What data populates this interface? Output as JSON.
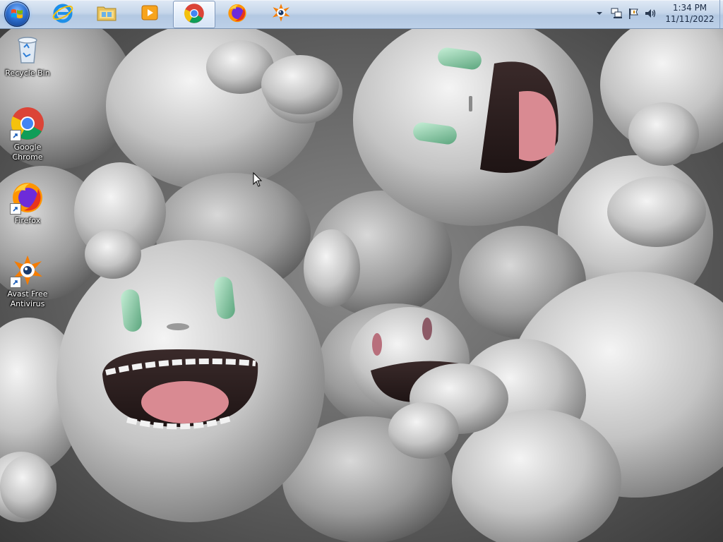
{
  "desktop": {
    "icons": [
      {
        "label": "Recycle Bin",
        "icon": "recycle-bin-icon",
        "shortcut": false
      },
      {
        "label": "Google Chrome",
        "icon": "chrome-icon",
        "shortcut": true
      },
      {
        "label": "Firefox",
        "icon": "firefox-icon",
        "shortcut": true
      },
      {
        "label": "Avast Free Antivirus",
        "icon": "avast-icon",
        "shortcut": true
      }
    ]
  },
  "taskbar": {
    "start_icon": "windows-logo-icon",
    "pinned": [
      {
        "name": "Internet Explorer",
        "icon": "internet-explorer-icon",
        "active": false
      },
      {
        "name": "Windows Explorer",
        "icon": "file-explorer-icon",
        "active": false
      },
      {
        "name": "Windows Media Player",
        "icon": "media-player-icon",
        "active": false
      },
      {
        "name": "Google Chrome",
        "icon": "chrome-icon",
        "active": true
      },
      {
        "name": "Firefox",
        "icon": "firefox-icon",
        "active": false
      },
      {
        "name": "Avast Free Antivirus",
        "icon": "avast-icon",
        "active": false
      }
    ],
    "tray": {
      "icons": [
        "show-hidden-icons-chevron-icon",
        "network-icon",
        "action-center-flag-icon",
        "volume-icon"
      ],
      "time": "1:34 PM",
      "date": "11/11/2022"
    }
  },
  "colors": {
    "taskbar_top": "#dfe9f5",
    "taskbar_bottom": "#bcd0e8",
    "chrome_red": "#db4437",
    "chrome_yellow": "#f4c20d",
    "chrome_green": "#0f9d58",
    "chrome_blue": "#4285f4",
    "avast_orange": "#f57c00",
    "wallpaper_green_eye": "#7fc8a0",
    "wallpaper_pink_mouth": "#d98a92"
  }
}
